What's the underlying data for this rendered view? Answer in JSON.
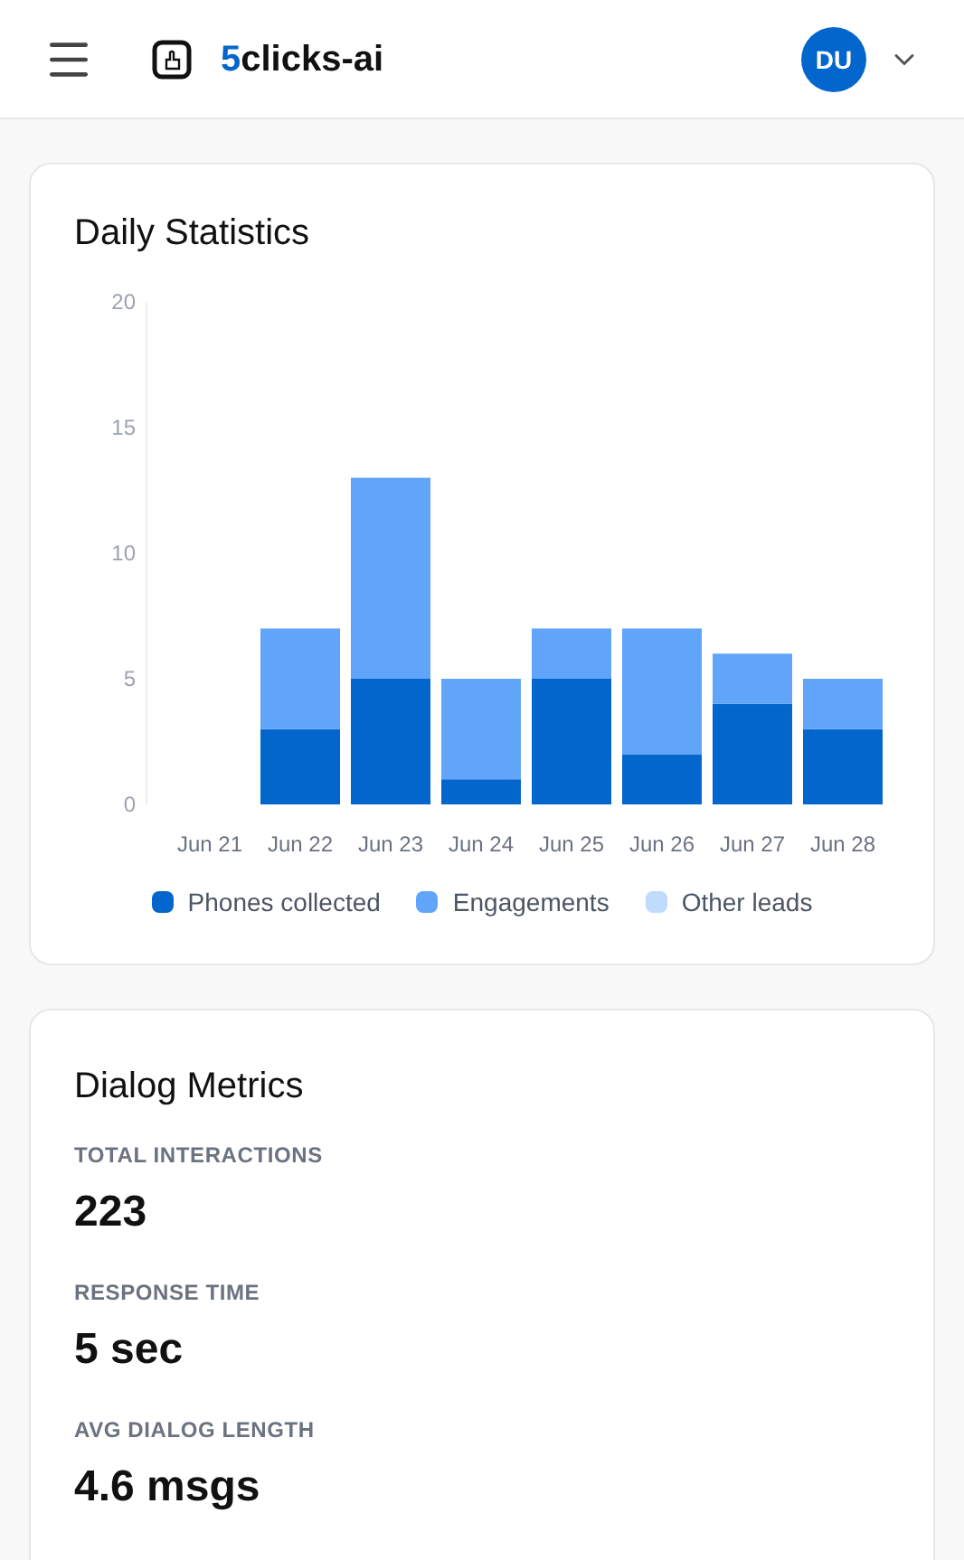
{
  "header": {
    "brand_accent": "5",
    "brand_rest": "clicks-ai",
    "avatar": "DU"
  },
  "daily_statistics": {
    "title": "Daily Statistics",
    "chart_data": {
      "type": "bar",
      "stacked": true,
      "legend": "bottom",
      "categories": [
        "Jun 21",
        "Jun 22",
        "Jun 23",
        "Jun 24",
        "Jun 25",
        "Jun 26",
        "Jun 27",
        "Jun 28"
      ],
      "ylim": [
        0,
        20
      ],
      "yticks": [
        0,
        5,
        10,
        15,
        20
      ],
      "series": [
        {
          "name": "Phones collected",
          "color": "#0366cc",
          "values": [
            0,
            3,
            5,
            1,
            5,
            2,
            4,
            3
          ]
        },
        {
          "name": "Engagements",
          "color": "#60a5fa",
          "values": [
            0,
            4,
            8,
            4,
            2,
            5,
            2,
            2
          ]
        },
        {
          "name": "Other leads",
          "color": "#bfdbfe",
          "values": [
            0,
            0,
            0,
            0,
            0,
            0,
            0,
            0
          ]
        }
      ]
    }
  },
  "dialog_metrics": {
    "title": "Dialog Metrics",
    "metrics": [
      {
        "label": "TOTAL INTERACTIONS",
        "value": "223"
      },
      {
        "label": "RESPONSE TIME",
        "value": "5 sec"
      },
      {
        "label": "AVG DIALOG LENGTH",
        "value": "4.6 msgs"
      }
    ]
  }
}
